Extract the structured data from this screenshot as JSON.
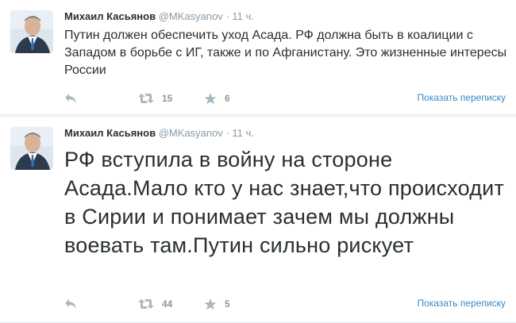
{
  "tweets": [
    {
      "fullname": "Михаил Касьянов",
      "handle": "@MKasyanov",
      "separator": "·",
      "time": "11 ч.",
      "text": "Путин должен обеспечить уход Асада. РФ должна быть в коалиции с Западом в борьбе с ИГ, также и по Афганистану. Это жизненные интересы России",
      "retweets": "15",
      "favorites": "6",
      "show_conversation": "Показать переписку"
    },
    {
      "fullname": "Михаил Касьянов",
      "handle": "@MKasyanov",
      "separator": "·",
      "time": "11 ч.",
      "text": "РФ вступила в войну на стороне Асада.Мало кто у нас знает,что происходит в Сирии и понимает зачем мы должны воевать там.Путин сильно рискует",
      "retweets": "44",
      "favorites": "5",
      "show_conversation": "Показать переписку"
    }
  ],
  "icons": {
    "reply": "reply-icon",
    "retweet": "retweet-icon",
    "favorite": "star-icon"
  },
  "colors": {
    "name": "#292f33",
    "meta": "#8899a6",
    "link": "#3b88c3",
    "icon": "#aab8c2",
    "divider": "#e1e8ed"
  }
}
